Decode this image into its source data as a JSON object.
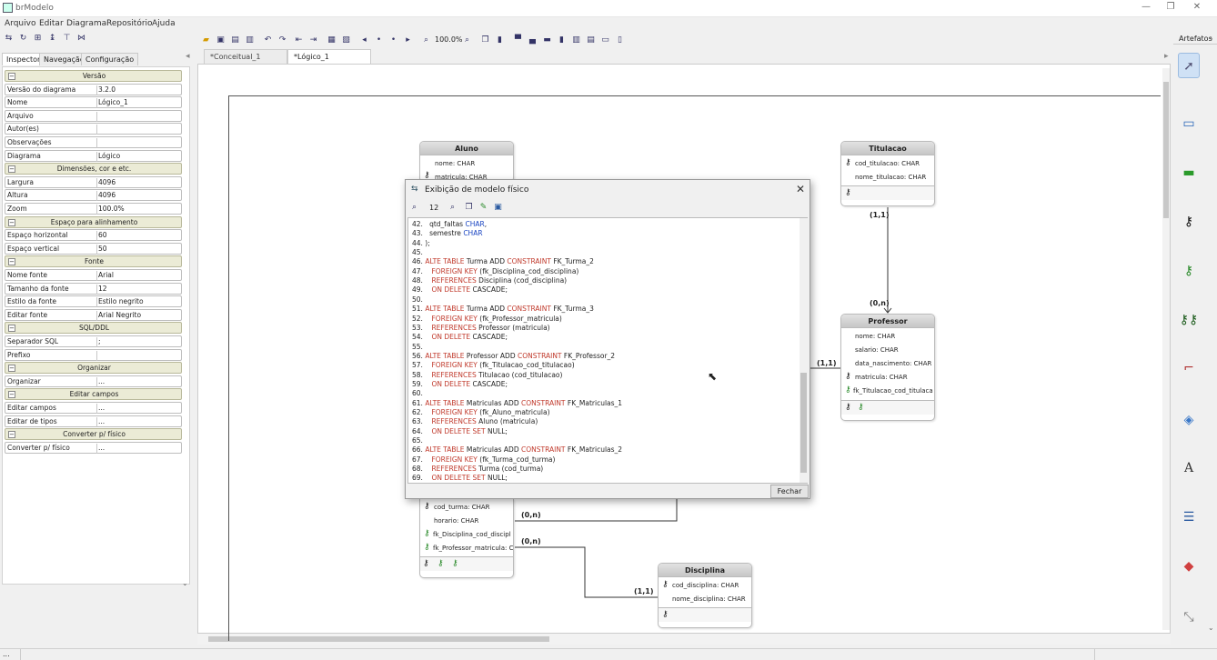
{
  "window": {
    "title": "brModelo"
  },
  "menu": [
    "Arquivo",
    "Editar",
    "Diagrama",
    "Repositório",
    "Ajuda"
  ],
  "toolbar": {
    "zoom": "100.0%"
  },
  "left_tabs": [
    "Inspector",
    "Navegação",
    "Configuração"
  ],
  "inspector": [
    {
      "group": "Versão"
    },
    {
      "k": "Versão do diagrama",
      "v": "3.2.0"
    },
    {
      "k": "Nome",
      "v": "Lógico_1"
    },
    {
      "k": "Arquivo",
      "v": ""
    },
    {
      "k": "Autor(es)",
      "v": ""
    },
    {
      "k": "Observações",
      "v": ""
    },
    {
      "k": "Diagrama",
      "v": "Lógico"
    },
    {
      "group": "Dimensões, cor e etc."
    },
    {
      "k": "Largura",
      "v": "4096"
    },
    {
      "k": "Altura",
      "v": "4096"
    },
    {
      "k": "Zoom",
      "v": "100.0%"
    },
    {
      "group": "Espaço para alinhamento"
    },
    {
      "k": "Espaço horizontal",
      "v": "60"
    },
    {
      "k": "Espaço vertical",
      "v": "50"
    },
    {
      "group": "Fonte"
    },
    {
      "k": "Nome fonte",
      "v": "Arial"
    },
    {
      "k": "Tamanho da fonte",
      "v": "12"
    },
    {
      "k": "Estilo da fonte",
      "v": "Estilo negrito"
    },
    {
      "k": "Editar fonte",
      "v": "Arial Negrito"
    },
    {
      "group": "SQL/DDL"
    },
    {
      "k": "Separador SQL",
      "v": ";"
    },
    {
      "k": "Prefixo",
      "v": ""
    },
    {
      "group": "Organizar"
    },
    {
      "k": "Organizar",
      "v": "..."
    },
    {
      "group": "Editar campos"
    },
    {
      "k": "Editar campos",
      "v": "..."
    },
    {
      "k": "Editar de tipos",
      "v": "..."
    },
    {
      "group": "Converter p/ físico"
    },
    {
      "k": "Converter p/ físico",
      "v": "..."
    }
  ],
  "doc_tabs": [
    "*Conceitual_1",
    "*Lógico_1"
  ],
  "right_panel": {
    "title": "Artefatos"
  },
  "entities": {
    "aluno": {
      "title": "Aluno",
      "fields": [
        "nome: CHAR",
        "matricula: CHAR"
      ]
    },
    "titulacao": {
      "title": "Titulacao",
      "fields": [
        "cod_titulacao: CHAR",
        "nome_titulacao: CHAR"
      ]
    },
    "professor": {
      "title": "Professor",
      "fields": [
        "nome: CHAR",
        "salario: CHAR",
        "data_nascimento: CHAR",
        "matricula: CHAR",
        "fk_Titulacao_cod_titulaca"
      ]
    },
    "turma": {
      "fields": [
        "cod_turma: CHAR",
        "horario: CHAR",
        "fk_Disciplina_cod_discipl",
        "fk_Professor_matricula: C"
      ]
    },
    "disciplina": {
      "title": "Disciplina",
      "fields": [
        "cod_disciplina: CHAR",
        "nome_disciplina: CHAR"
      ]
    }
  },
  "cardinalities": {
    "tit_a": "(1,1)",
    "tit_b": "(0,n)",
    "prof_a": "(1,1)",
    "turma_a": "(0,n)",
    "turma_b": "(0,n)",
    "disc_a": "(1,1)"
  },
  "dialog": {
    "title": "Exibição de modelo físico",
    "font_size": "12",
    "close_button": "Fechar",
    "lines": [
      [
        [
          "42.   ",
          ""
        ],
        [
          "qtd_faltas ",
          ""
        ],
        [
          "CHAR",
          "ty"
        ],
        [
          ",",
          ""
        ]
      ],
      [
        [
          "43.   ",
          ""
        ],
        [
          "semestre ",
          ""
        ],
        [
          "CHAR",
          "ty"
        ]
      ],
      [
        [
          "44. );",
          ""
        ]
      ],
      [
        [
          "45.",
          ""
        ]
      ],
      [
        [
          "46. ",
          ""
        ],
        [
          "ALTE TABLE",
          "kw"
        ],
        [
          " Turma ADD ",
          ""
        ],
        [
          "CONSTRAINT",
          "kw"
        ],
        [
          " FK_Turma_2",
          ""
        ]
      ],
      [
        [
          "47.    ",
          ""
        ],
        [
          "FOREIGN KEY",
          "kw"
        ],
        [
          " (fk_Disciplina_cod_disciplina)",
          ""
        ]
      ],
      [
        [
          "48.    ",
          ""
        ],
        [
          "REFERENCES",
          "kw"
        ],
        [
          " Disciplina (cod_disciplina)",
          ""
        ]
      ],
      [
        [
          "49.    ",
          ""
        ],
        [
          "ON DELETE",
          "kw"
        ],
        [
          " CASCADE;",
          ""
        ]
      ],
      [
        [
          "50.",
          ""
        ]
      ],
      [
        [
          "51. ",
          ""
        ],
        [
          "ALTE TABLE",
          "kw"
        ],
        [
          " Turma ADD ",
          ""
        ],
        [
          "CONSTRAINT",
          "kw"
        ],
        [
          " FK_Turma_3",
          ""
        ]
      ],
      [
        [
          "52.    ",
          ""
        ],
        [
          "FOREIGN KEY",
          "kw"
        ],
        [
          " (fk_Professor_matricula)",
          ""
        ]
      ],
      [
        [
          "53.    ",
          ""
        ],
        [
          "REFERENCES",
          "kw"
        ],
        [
          " Professor (matricula)",
          ""
        ]
      ],
      [
        [
          "54.    ",
          ""
        ],
        [
          "ON DELETE",
          "kw"
        ],
        [
          " CASCADE;",
          ""
        ]
      ],
      [
        [
          "55.",
          ""
        ]
      ],
      [
        [
          "56. ",
          ""
        ],
        [
          "ALTE TABLE",
          "kw"
        ],
        [
          " Professor ADD ",
          ""
        ],
        [
          "CONSTRAINT",
          "kw"
        ],
        [
          " FK_Professor_2",
          ""
        ]
      ],
      [
        [
          "57.    ",
          ""
        ],
        [
          "FOREIGN KEY",
          "kw"
        ],
        [
          " (fk_Titulacao_cod_titulacao)",
          ""
        ]
      ],
      [
        [
          "58.    ",
          ""
        ],
        [
          "REFERENCES",
          "kw"
        ],
        [
          " Titulacao (cod_titulacao)",
          ""
        ]
      ],
      [
        [
          "59.    ",
          ""
        ],
        [
          "ON DELETE",
          "kw"
        ],
        [
          " CASCADE;",
          ""
        ]
      ],
      [
        [
          "60.",
          ""
        ]
      ],
      [
        [
          "61. ",
          ""
        ],
        [
          "ALTE TABLE",
          "kw"
        ],
        [
          " Matriculas ADD ",
          ""
        ],
        [
          "CONSTRAINT",
          "kw"
        ],
        [
          " FK_Matriculas_1",
          ""
        ]
      ],
      [
        [
          "62.    ",
          ""
        ],
        [
          "FOREIGN KEY",
          "kw"
        ],
        [
          " (fk_Aluno_matricula)",
          ""
        ]
      ],
      [
        [
          "63.    ",
          ""
        ],
        [
          "REFERENCES",
          "kw"
        ],
        [
          " Aluno (matricula)",
          ""
        ]
      ],
      [
        [
          "64.    ",
          ""
        ],
        [
          "ON DELETE SET",
          "kw"
        ],
        [
          " NULL;",
          ""
        ]
      ],
      [
        [
          "65.",
          ""
        ]
      ],
      [
        [
          "66. ",
          ""
        ],
        [
          "ALTE TABLE",
          "kw"
        ],
        [
          " Matriculas ADD ",
          ""
        ],
        [
          "CONSTRAINT",
          "kw"
        ],
        [
          " FK_Matriculas_2",
          ""
        ]
      ],
      [
        [
          "67.    ",
          ""
        ],
        [
          "FOREIGN KEY",
          "kw"
        ],
        [
          " (fk_Turma_cod_turma)",
          ""
        ]
      ],
      [
        [
          "68.    ",
          ""
        ],
        [
          "REFERENCES",
          "kw"
        ],
        [
          " Turma (cod_turma)",
          ""
        ]
      ],
      [
        [
          "69.    ",
          ""
        ],
        [
          "ON DELETE SET",
          "kw"
        ],
        [
          " NULL;",
          ""
        ]
      ]
    ]
  },
  "status": {
    "left": "..."
  }
}
